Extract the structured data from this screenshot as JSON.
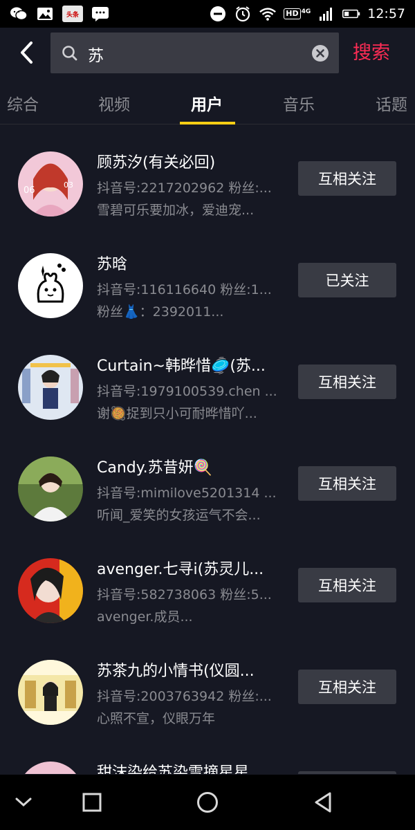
{
  "status_bar": {
    "toutiao_label": "头条",
    "hd_label": "HD",
    "network": "4G",
    "time": "12:57"
  },
  "search": {
    "query": "苏",
    "submit_label": "搜索"
  },
  "tabs": [
    {
      "label": "综合"
    },
    {
      "label": "视频"
    },
    {
      "label": "用户"
    },
    {
      "label": "音乐"
    },
    {
      "label": "话题"
    }
  ],
  "users": [
    {
      "name": "顾苏汐(有关必回)",
      "info": "抖音号:2217202962 粉丝:...",
      "desc": "雪碧可乐要加冰，爱迪宠...",
      "action": "互相关注",
      "avatar_color": "#e9a7c4"
    },
    {
      "name": "苏晗",
      "info": "抖音号:116116640 粉丝:1...",
      "desc": "粉丝👗：2392011...",
      "action": "已关注",
      "avatar_color": "#ffffff"
    },
    {
      "name": "Curtain~韩晔惜🥏(苏...",
      "info": "抖音号:1979100539.chen ...",
      "desc": "谢🥘捉到只小可耐晔惜吖...",
      "action": "互相关注",
      "avatar_color": "#b9c7e0"
    },
    {
      "name": "Candy.苏昔妍🍭",
      "info": "抖音号:mimilove5201314 ...",
      "desc": "听闻_爱笑的女孩运气不会...",
      "action": "互相关注",
      "avatar_color": "#6f8a4a"
    },
    {
      "name": "avenger.七寻i(苏灵儿...",
      "info": "抖音号:582738063 粉丝:5...",
      "desc": "avenger.成员...",
      "action": "互相关注",
      "avatar_color": "#e23a2a"
    },
    {
      "name": "苏茶九的小情书(仪圆...",
      "info": "抖音号:2003763942 粉丝:...",
      "desc": "心照不宣，仪眼万年",
      "action": "互相关注",
      "avatar_color": "#d9b84a"
    },
    {
      "name": "甜沫染给苏染雪摘星星...",
      "info": "",
      "desc": "",
      "action": "",
      "avatar_color": "#e7b3c8"
    }
  ]
}
